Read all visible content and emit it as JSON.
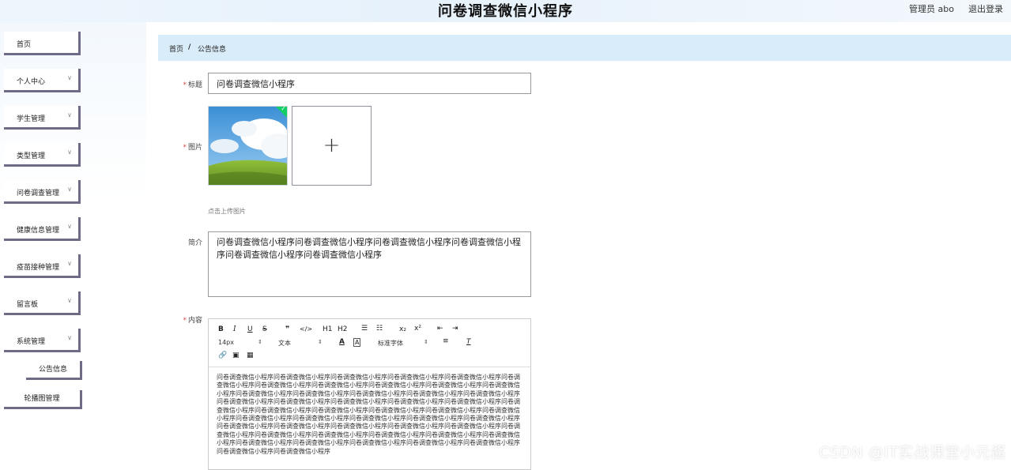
{
  "header": {
    "title": "问卷调查微信小程序",
    "user": "管理员 abo",
    "logout": "退出登录"
  },
  "sidebar": {
    "items": [
      {
        "label": "首页",
        "has_arrow": false
      },
      {
        "label": "个人中心",
        "has_arrow": true
      },
      {
        "label": "学生管理",
        "has_arrow": true
      },
      {
        "label": "类型管理",
        "has_arrow": true
      },
      {
        "label": "问卷调查管理",
        "has_arrow": true
      },
      {
        "label": "健康信息管理",
        "has_arrow": true
      },
      {
        "label": "疫苗接种管理",
        "has_arrow": true
      },
      {
        "label": "留言板",
        "has_arrow": true
      },
      {
        "label": "系统管理",
        "has_arrow": true
      }
    ],
    "sub_items": [
      "公告信息",
      "轮播图管理"
    ]
  },
  "breadcrumb": {
    "home": "首页",
    "separator": "/",
    "current": "公告信息"
  },
  "form": {
    "title_label": "标题",
    "title_value": "问卷调查微信小程序",
    "image_label": "图片",
    "upload_tip": "点击上传图片",
    "intro_label": "简介",
    "intro_value": "问卷调查微信小程序问卷调查微信小程序问卷调查微信小程序问卷调查微信小程序问卷调查微信小程序问卷调查微信小程序",
    "content_label": "内容",
    "required_mark": "*"
  },
  "editor": {
    "toolbar_row1": [
      "B",
      "I",
      "U",
      "S",
      "❞",
      "</>",
      "H1",
      "H2",
      "☰",
      "☷",
      "x₂",
      "x²",
      "⇤",
      "⇥"
    ],
    "font_size": "14px",
    "block_type": "文本",
    "font_family": "标准字体",
    "content": "问卷调查微信小程序问卷调查微信小程序问卷调查微信小程序问卷调查微信小程序问卷调查微信小程序问卷调查微信小程序问卷调查微信小程序问卷调查微信小程序问卷调查微信小程序问卷调查微信小程序问卷调查微信小程序问卷调查微信小程序问卷调查微信小程序问卷调查微信小程序问卷调查微信小程序问卷调查微信小程序问卷调查微信小程序问卷调查微信小程序问卷调查微信小程序问卷调查微信小程序问卷调查微信小程序问卷调查微信小程序问卷调查微信小程序问卷调查微信小程序问卷调查微信小程序问卷调查微信小程序问卷调查微信小程序问卷调查微信小程序问卷调查微信小程序问卷调查微信小程序问卷调查微信小程序问卷调查微信小程序问卷调查微信小程序问卷调查微信小程序问卷调查微信小程序问卷调查微信小程序问卷调查微信小程序问卷调查微信小程序问卷调查微信小程序问卷调查微信小程序问卷调查微信小程序问卷调查微信小程序问卷调查微信小程序问卷调查微信小程序问卷调查微信小程序问卷调查微信小程序问卷调查微信小程序问卷调查微信小程序问卷调查微信小程序问卷调查微信小程序"
  },
  "watermark": "CSDN @IT实战课堂小元酱",
  "colors": {
    "accent_border": "#6f6a86",
    "breadcrumb_bg": "#d9ecf9",
    "required": "#e04848",
    "success_check": "#13ce66"
  }
}
